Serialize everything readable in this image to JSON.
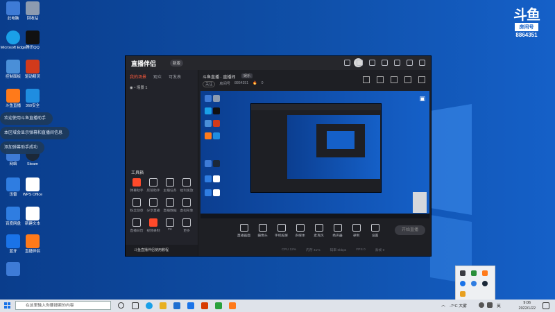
{
  "desktop": {
    "icons": [
      {
        "label": "此电脑",
        "color": "#3e7bd6"
      },
      {
        "label": "回收站",
        "color": "#8c9bb0"
      },
      {
        "label": "Microsoft Edge",
        "color": "#1aa0e8"
      },
      {
        "label": "腾讯QQ",
        "color": "#111111"
      },
      {
        "label": "控制面板",
        "color": "#4a8fd8"
      },
      {
        "label": "驱动精灵",
        "color": "#d23a1b"
      },
      {
        "label": "斗鱼直播",
        "color": "#ff7a1a"
      },
      {
        "label": "360安全",
        "color": "#1f8de0"
      },
      {
        "label": "Steam",
        "color": "#1b2838"
      },
      {
        "label": "网络",
        "color": "#3e7bd6"
      },
      {
        "label": "WPS Office",
        "color": "#ffffff"
      },
      {
        "label": "迅雷",
        "color": "#2f7de1"
      },
      {
        "label": "新建文本",
        "color": "#ffffff"
      },
      {
        "label": "百度网盘",
        "color": "#2f7de1"
      },
      {
        "label": "直播伴侣",
        "color": "#ff7a1a"
      },
      {
        "label": "蓝牙",
        "color": "#1a73e8"
      }
    ],
    "notifications": [
      "欢迎使用斗鱼直播助手",
      "本区域会显示弹幕和直播间信息",
      "添加弹幕助手成功"
    ]
  },
  "brand": {
    "mark": "斗鱼",
    "label": "房间号",
    "room_number": "8864351"
  },
  "app": {
    "logo_text": "直播伴侣",
    "version_badge": "新版",
    "left_tabs": [
      "我的场景",
      "观众",
      "可发表"
    ],
    "scene_name": "场景 1",
    "tools_title": "工具箱",
    "tools": [
      "弹幕助手",
      "房管助手",
      "主播任务",
      "福利发放",
      "粉丝勋章",
      "分享直播",
      "直播数据",
      "虚拟形象",
      "直播日历",
      "视频录制",
      "PK",
      "更多"
    ],
    "notice_text": "斗鱼直播伴侣使用教程",
    "room_title": "斗鱼直播 · 直播间",
    "room_badge": "娱乐",
    "room_fav": "关注",
    "room_id_label": "房间号",
    "room_id": "8864351",
    "followers": "0",
    "controls": [
      "直播画面",
      "摄像头",
      "手机投屏",
      "多媒体",
      "麦克风",
      "扬声器",
      "录制",
      "",
      "设置"
    ],
    "start_button": "开始直播",
    "status_items": [
      "CPU 12%",
      "内存 41%",
      "码率 0kbps",
      "FPS 0",
      "丢帧 0"
    ]
  },
  "taskbar": {
    "search_placeholder": "在这里输入你要搜索的内容",
    "weather": "-7°C 大雾",
    "lang": "英",
    "time": "9:06",
    "date": "2022/1/22"
  }
}
